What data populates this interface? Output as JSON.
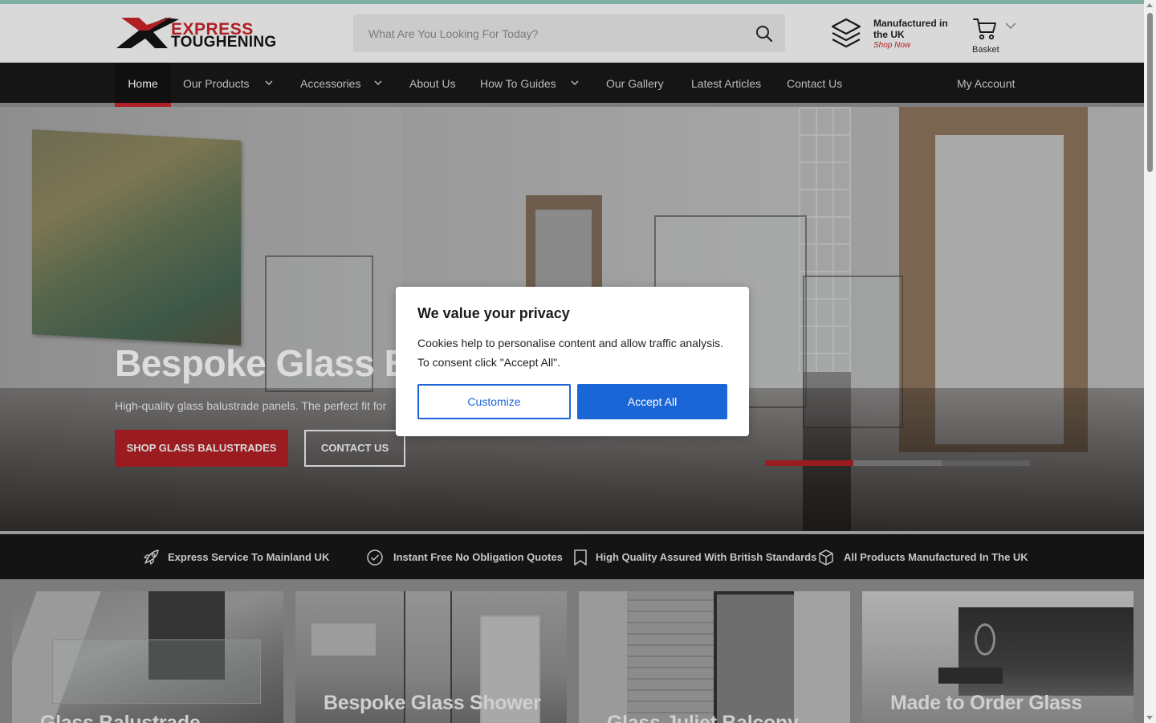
{
  "header": {
    "logo_line1": "EXPRESS",
    "logo_line2": "TOUGHENING",
    "search_placeholder": "What Are You Looking For Today?",
    "manufactured": "Manufactured in the UK",
    "shop_now": "Shop Now",
    "basket_label": "Basket"
  },
  "nav": {
    "items": [
      {
        "label": "Home",
        "active": true
      },
      {
        "label": "Our Products",
        "dropdown": true
      },
      {
        "label": "Accessories",
        "dropdown": true
      },
      {
        "label": "About Us"
      },
      {
        "label": "How To Guides",
        "dropdown": true
      },
      {
        "label": "Our Gallery"
      },
      {
        "label": "Latest Articles"
      },
      {
        "label": "Contact Us"
      },
      {
        "label": "My Account"
      }
    ]
  },
  "hero": {
    "title": "Bespoke Glass Bal",
    "subtitle": "High-quality glass balustrade panels. The perfect fit for",
    "primary_button": "SHOP GLASS BALUSTRADES",
    "secondary_button": "CONTACT US",
    "slides_total": 3,
    "active_slide": 1
  },
  "features": [
    {
      "icon": "rocket-icon",
      "label": "Express Service To Mainland UK"
    },
    {
      "icon": "check-circle-icon",
      "label": "Instant Free No Obligation Quotes"
    },
    {
      "icon": "bookmark-icon",
      "label": "High Quality Assured With British Standards"
    },
    {
      "icon": "box-icon",
      "label": "All Products Manufactured In The UK"
    }
  ],
  "cards": [
    {
      "title": "Glass Balustrade"
    },
    {
      "title": "Bespoke Glass Shower"
    },
    {
      "title": "Glass Juliet Balcony"
    },
    {
      "title": "Made to Order Glass"
    }
  ],
  "cookie": {
    "title": "We value your privacy",
    "body": "Cookies help to personalise content and allow traffic analysis. To consent click \"Accept All\".",
    "customize": "Customize",
    "accept": "Accept All"
  },
  "colors": {
    "brand_red": "#b01f24",
    "accent_blue": "#1a66d6",
    "nav_bg": "#151515"
  }
}
